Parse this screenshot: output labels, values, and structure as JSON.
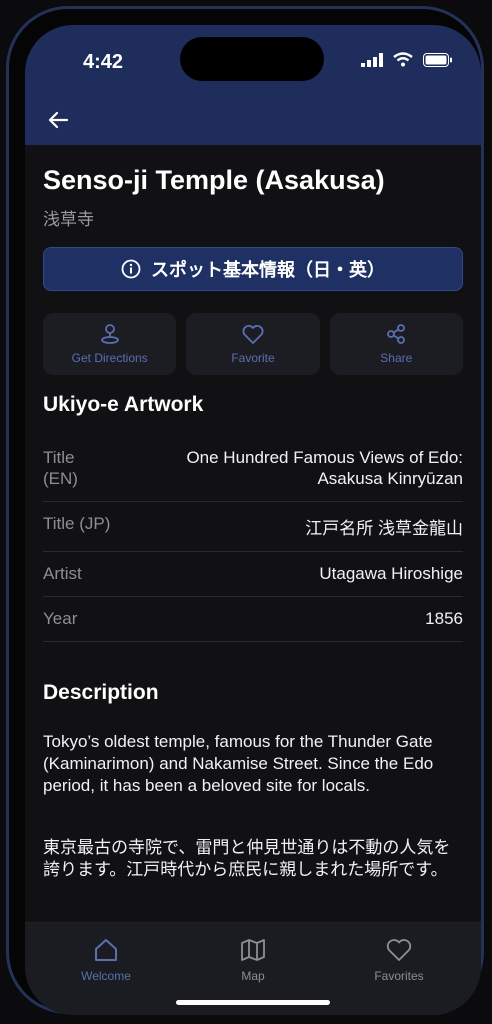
{
  "status_bar": {
    "time": "4:42"
  },
  "header": {
    "back_icon": "arrow-left-icon"
  },
  "spot": {
    "title": "Senso-ji Temple (Asakusa)",
    "subtitle_jp": "浅草寺",
    "info_button_label": "スポット基本情報（日・英）"
  },
  "actions": [
    {
      "label": "Get Directions",
      "icon": "map-pin-icon"
    },
    {
      "label": "Favorite",
      "icon": "heart-icon"
    },
    {
      "label": "Share",
      "icon": "share-icon"
    }
  ],
  "artwork": {
    "section_title": "Ukiyo-e Artwork",
    "rows": [
      {
        "key": "Title (EN)",
        "value": "One Hundred Famous Views of Edo: Asakusa Kinryūzan"
      },
      {
        "key": "Title (JP)",
        "value": "江戸名所 浅草金龍山"
      },
      {
        "key": "Artist",
        "value": "Utagawa Hiroshige"
      },
      {
        "key": "Year",
        "value": "1856"
      }
    ]
  },
  "description": {
    "section_title": "Description",
    "text_en": "Tokyo’s oldest temple, famous for the Thunder Gate (Kaminarimon) and Nakamise Street. Since the Edo period, it has been a beloved site for locals.",
    "text_jp": "東京最古の寺院で、雷門と仲見世通りは不動の人気を誇ります。江戸時代から庶民に親しまれた場所です。"
  },
  "tabbar": {
    "items": [
      {
        "label": "Welcome",
        "icon": "home-icon",
        "active": true
      },
      {
        "label": "Map",
        "icon": "map-icon",
        "active": false
      },
      {
        "label": "Favorites",
        "icon": "heart-icon",
        "active": false
      }
    ]
  },
  "colors": {
    "header_bg": "#1e2d5c",
    "accent": "#5a6fb0",
    "button_bg": "#1f3164"
  }
}
